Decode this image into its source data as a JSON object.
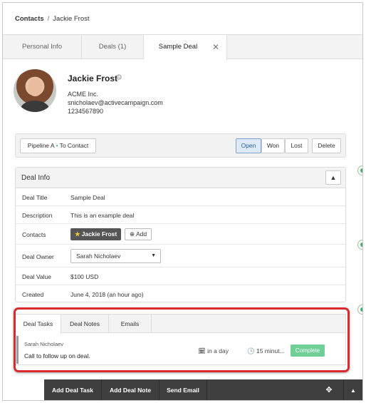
{
  "breadcrumb": {
    "root": "Contacts",
    "separator": "/",
    "current": "Jackie Frost"
  },
  "tabs": [
    {
      "label": "Personal Info"
    },
    {
      "label": "Deals (1)"
    },
    {
      "label": "Sample Deal",
      "close": "✕"
    }
  ],
  "profile": {
    "name": "Jackie Frost",
    "gear": "⚙",
    "company": "ACME Inc.",
    "email": "snicholaev@activecampaign.com",
    "phone": "1234567890"
  },
  "pipeline": {
    "pipeline_name": "Pipeline A",
    "dot": "•",
    "stage": "To Contact",
    "status_buttons": [
      "Open",
      "Won",
      "Lost"
    ],
    "delete_label": "Delete",
    "active_status": "Open"
  },
  "deal_info": {
    "header": "Deal Info",
    "collapse_glyph": "▲",
    "rows": {
      "title": {
        "label": "Deal Title",
        "value": "Sample Deal"
      },
      "description": {
        "label": "Description",
        "value": "This is an example deal"
      },
      "contacts": {
        "label": "Contacts",
        "chip": "Jackie Frost",
        "star": "★",
        "add": "⊕ Add"
      },
      "owner": {
        "label": "Deal Owner",
        "value": "Sarah Nicholaev",
        "caret": "▼"
      },
      "value": {
        "label": "Deal Value",
        "value": "$100 USD"
      },
      "created": {
        "label": "Created",
        "value": "June 4, 2018 (an hour ago)"
      }
    }
  },
  "task_panel": {
    "tabs": [
      "Deal Tasks",
      "Deal Notes",
      "Emails"
    ],
    "active_tab": "Deal Tasks",
    "task": {
      "owner": "Sarah Nicholaev",
      "title": "Call to follow up on deal.",
      "due_icon": "🗓",
      "due": "in a day",
      "duration_icon": "🕒",
      "duration": "15 minut...",
      "complete_label": "Complete"
    }
  },
  "bottom_bar": {
    "buttons": [
      "Add Deal Task",
      "Add Deal Note",
      "Send Email"
    ],
    "move_icon": "✥",
    "toggle_icon": "▲"
  },
  "colors": {
    "highlight": "#d92b2b",
    "accent_green": "#6fcf97",
    "open_button": "#dde9f6",
    "bottom_bar": "#3f3f3f"
  }
}
